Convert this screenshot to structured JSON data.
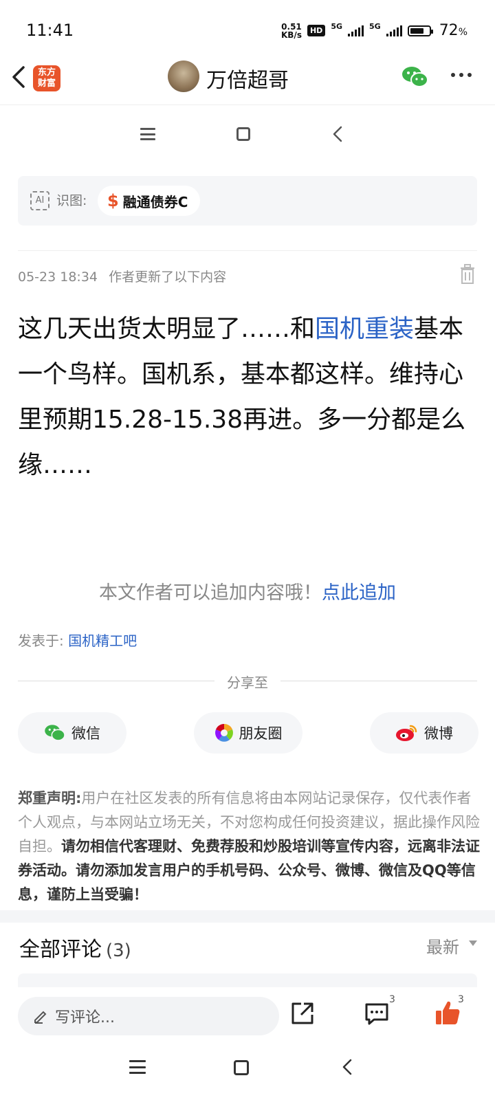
{
  "status_bar": {
    "time": "11:41",
    "net_speed": "0.51",
    "net_unit": "KB/s",
    "hd": "HD",
    "sim1": "5G",
    "sim2": "5G",
    "battery_percent": "72",
    "battery_unit": "%",
    "battery_level": 0.72
  },
  "header": {
    "app_logo_line1": "东方",
    "app_logo_line2": "财富",
    "author": "万倍超哥"
  },
  "ai_recognition": {
    "icon_text": "AI",
    "label": "识图:",
    "fund_symbol": "$",
    "fund_name": "融通债券C"
  },
  "post": {
    "timestamp": "05-23 18:34",
    "meta": "作者更新了以下内容",
    "body_part1": "这几天出货太明显了……和",
    "body_link": "国机重装",
    "body_part2": "基本一个鸟样。国机系，基本都这样。维持心里预期15.28-15.38再进。多一分都是么缘……"
  },
  "append": {
    "text": "本文作者可以追加内容哦！",
    "link": "点此追加"
  },
  "board": {
    "label": "发表于:",
    "name": "国机精工吧"
  },
  "share": {
    "title": "分享至",
    "wechat": "微信",
    "moments": "朋友圈",
    "weibo": "微博"
  },
  "disclaimer": {
    "title": "郑重声明:",
    "text1": "用户在社区发表的所有信息将由本网站记录保存，仅代表作者个人观点，与本网站立场无关，不对您构成任何投资建议，据此操作风险自担。",
    "text2": "请勿相信代客理财、免费荐股和炒股培训等宣传内容，远离非法证券活动。请勿添加发言用户的手机号码、公众号、微博、微信及QQ等信息，谨防上当受骗！"
  },
  "comments": {
    "title": "全部评论",
    "count": "(3)",
    "sort": "最新"
  },
  "bottom_bar": {
    "input_placeholder": "写评论...",
    "comment_count": "3",
    "like_count": "3"
  },
  "colors": {
    "accent_orange": "#e8542a",
    "link_blue": "#2b63c6",
    "wechat_green": "#3cb34a"
  }
}
